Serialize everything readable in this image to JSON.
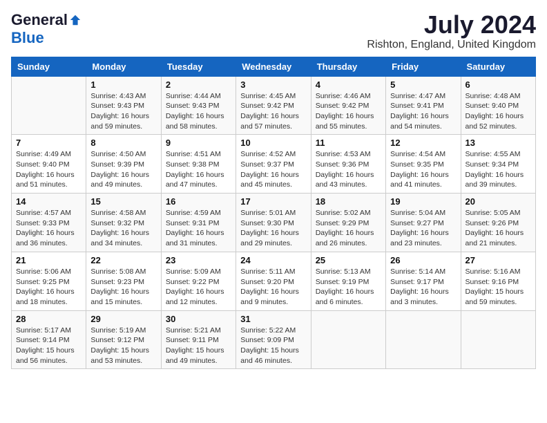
{
  "logo": {
    "general": "General",
    "blue": "Blue"
  },
  "title": {
    "month_year": "July 2024",
    "location": "Rishton, England, United Kingdom"
  },
  "weekdays": [
    "Sunday",
    "Monday",
    "Tuesday",
    "Wednesday",
    "Thursday",
    "Friday",
    "Saturday"
  ],
  "weeks": [
    [
      {
        "day": "",
        "info": ""
      },
      {
        "day": "1",
        "info": "Sunrise: 4:43 AM\nSunset: 9:43 PM\nDaylight: 16 hours\nand 59 minutes."
      },
      {
        "day": "2",
        "info": "Sunrise: 4:44 AM\nSunset: 9:43 PM\nDaylight: 16 hours\nand 58 minutes."
      },
      {
        "day": "3",
        "info": "Sunrise: 4:45 AM\nSunset: 9:42 PM\nDaylight: 16 hours\nand 57 minutes."
      },
      {
        "day": "4",
        "info": "Sunrise: 4:46 AM\nSunset: 9:42 PM\nDaylight: 16 hours\nand 55 minutes."
      },
      {
        "day": "5",
        "info": "Sunrise: 4:47 AM\nSunset: 9:41 PM\nDaylight: 16 hours\nand 54 minutes."
      },
      {
        "day": "6",
        "info": "Sunrise: 4:48 AM\nSunset: 9:40 PM\nDaylight: 16 hours\nand 52 minutes."
      }
    ],
    [
      {
        "day": "7",
        "info": "Sunrise: 4:49 AM\nSunset: 9:40 PM\nDaylight: 16 hours\nand 51 minutes."
      },
      {
        "day": "8",
        "info": "Sunrise: 4:50 AM\nSunset: 9:39 PM\nDaylight: 16 hours\nand 49 minutes."
      },
      {
        "day": "9",
        "info": "Sunrise: 4:51 AM\nSunset: 9:38 PM\nDaylight: 16 hours\nand 47 minutes."
      },
      {
        "day": "10",
        "info": "Sunrise: 4:52 AM\nSunset: 9:37 PM\nDaylight: 16 hours\nand 45 minutes."
      },
      {
        "day": "11",
        "info": "Sunrise: 4:53 AM\nSunset: 9:36 PM\nDaylight: 16 hours\nand 43 minutes."
      },
      {
        "day": "12",
        "info": "Sunrise: 4:54 AM\nSunset: 9:35 PM\nDaylight: 16 hours\nand 41 minutes."
      },
      {
        "day": "13",
        "info": "Sunrise: 4:55 AM\nSunset: 9:34 PM\nDaylight: 16 hours\nand 39 minutes."
      }
    ],
    [
      {
        "day": "14",
        "info": "Sunrise: 4:57 AM\nSunset: 9:33 PM\nDaylight: 16 hours\nand 36 minutes."
      },
      {
        "day": "15",
        "info": "Sunrise: 4:58 AM\nSunset: 9:32 PM\nDaylight: 16 hours\nand 34 minutes."
      },
      {
        "day": "16",
        "info": "Sunrise: 4:59 AM\nSunset: 9:31 PM\nDaylight: 16 hours\nand 31 minutes."
      },
      {
        "day": "17",
        "info": "Sunrise: 5:01 AM\nSunset: 9:30 PM\nDaylight: 16 hours\nand 29 minutes."
      },
      {
        "day": "18",
        "info": "Sunrise: 5:02 AM\nSunset: 9:29 PM\nDaylight: 16 hours\nand 26 minutes."
      },
      {
        "day": "19",
        "info": "Sunrise: 5:04 AM\nSunset: 9:27 PM\nDaylight: 16 hours\nand 23 minutes."
      },
      {
        "day": "20",
        "info": "Sunrise: 5:05 AM\nSunset: 9:26 PM\nDaylight: 16 hours\nand 21 minutes."
      }
    ],
    [
      {
        "day": "21",
        "info": "Sunrise: 5:06 AM\nSunset: 9:25 PM\nDaylight: 16 hours\nand 18 minutes."
      },
      {
        "day": "22",
        "info": "Sunrise: 5:08 AM\nSunset: 9:23 PM\nDaylight: 16 hours\nand 15 minutes."
      },
      {
        "day": "23",
        "info": "Sunrise: 5:09 AM\nSunset: 9:22 PM\nDaylight: 16 hours\nand 12 minutes."
      },
      {
        "day": "24",
        "info": "Sunrise: 5:11 AM\nSunset: 9:20 PM\nDaylight: 16 hours\nand 9 minutes."
      },
      {
        "day": "25",
        "info": "Sunrise: 5:13 AM\nSunset: 9:19 PM\nDaylight: 16 hours\nand 6 minutes."
      },
      {
        "day": "26",
        "info": "Sunrise: 5:14 AM\nSunset: 9:17 PM\nDaylight: 16 hours\nand 3 minutes."
      },
      {
        "day": "27",
        "info": "Sunrise: 5:16 AM\nSunset: 9:16 PM\nDaylight: 15 hours\nand 59 minutes."
      }
    ],
    [
      {
        "day": "28",
        "info": "Sunrise: 5:17 AM\nSunset: 9:14 PM\nDaylight: 15 hours\nand 56 minutes."
      },
      {
        "day": "29",
        "info": "Sunrise: 5:19 AM\nSunset: 9:12 PM\nDaylight: 15 hours\nand 53 minutes."
      },
      {
        "day": "30",
        "info": "Sunrise: 5:21 AM\nSunset: 9:11 PM\nDaylight: 15 hours\nand 49 minutes."
      },
      {
        "day": "31",
        "info": "Sunrise: 5:22 AM\nSunset: 9:09 PM\nDaylight: 15 hours\nand 46 minutes."
      },
      {
        "day": "",
        "info": ""
      },
      {
        "day": "",
        "info": ""
      },
      {
        "day": "",
        "info": ""
      }
    ]
  ]
}
